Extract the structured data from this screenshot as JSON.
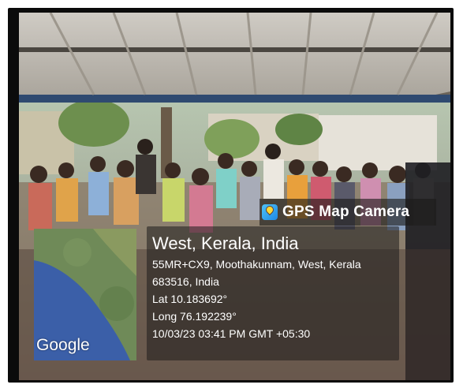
{
  "badge": {
    "label": "GPS Map Camera",
    "icon": "gps-map-camera-app-icon"
  },
  "map": {
    "provider_label": "Google"
  },
  "location": {
    "title": "West, Kerala, India",
    "address_line1": "55MR+CX9, Moothakunnam, West, Kerala",
    "address_line2": "683516, India",
    "latitude": "Lat 10.183692°",
    "longitude": "Long 76.192239°",
    "timestamp": "10/03/23 03:41 PM GMT +05:30"
  },
  "colors": {
    "frame": "#0b0b0b",
    "overlay": "#1e1c1b",
    "sea": "#3b5fa8",
    "land": "#6f8a58",
    "roof": "#c8c4bd"
  }
}
